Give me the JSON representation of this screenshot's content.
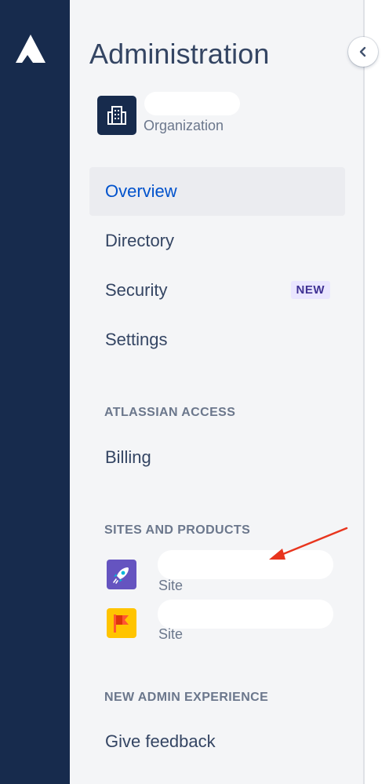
{
  "global_nav": {
    "logo_icon": "atlassian-logo"
  },
  "panel": {
    "title": "Administration",
    "organization": {
      "name": "",
      "type": "Organization",
      "icon": "building-icon"
    },
    "nav": [
      {
        "label": "Overview",
        "selected": true
      },
      {
        "label": "Directory"
      },
      {
        "label": "Security",
        "badge": "NEW"
      },
      {
        "label": "Settings"
      }
    ],
    "access_section": {
      "heading": "ATLASSIAN ACCESS",
      "items": [
        {
          "label": "Billing"
        }
      ]
    },
    "sites_section": {
      "heading": "SITES AND PRODUCTS",
      "sites": [
        {
          "name": "",
          "type": "Site",
          "icon": "rocket-icon",
          "color": "#6554c0"
        },
        {
          "name": "",
          "type": "Site",
          "icon": "flag-icon",
          "color": "#ffc400"
        }
      ]
    },
    "admin_section": {
      "heading": "NEW ADMIN EXPERIENCE",
      "items": [
        {
          "label": "Give feedback"
        }
      ]
    }
  },
  "annotation": {
    "arrow_color": "#e8351e"
  },
  "colors": {
    "sidebar": "#172b4d",
    "panel_bg": "#f4f5f7",
    "selected_text": "#0052cc",
    "badge_bg": "#eae6ff",
    "badge_text": "#403294"
  }
}
